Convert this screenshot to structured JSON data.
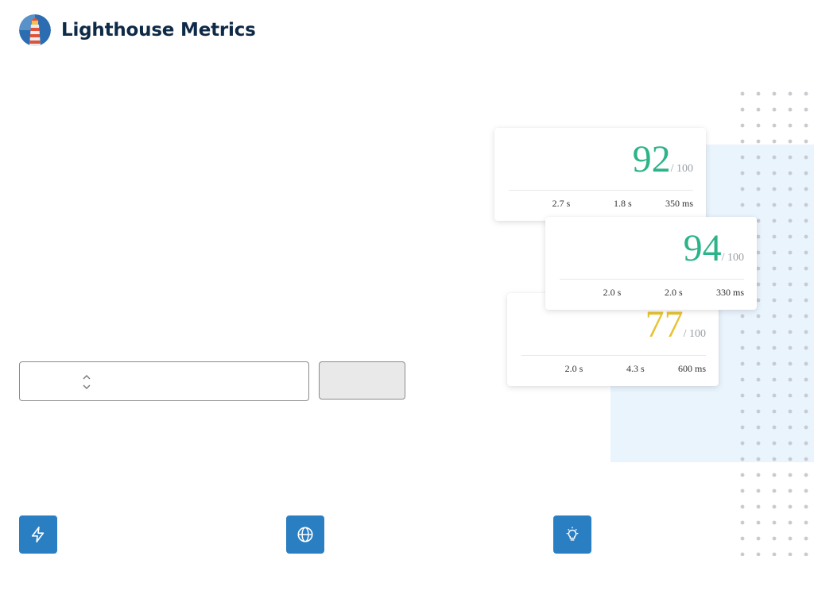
{
  "header": {
    "brand": "Lighthouse Metrics",
    "logo_icon": "lighthouse-icon"
  },
  "colors": {
    "good": "#2bb389",
    "average": "#e8c232",
    "accent": "#2a7ec2",
    "brand_text": "#0f2a47"
  },
  "cards": [
    {
      "score": "92",
      "out_of": "/ 100",
      "status": "good",
      "metrics": [
        "2.7 s",
        "1.8 s",
        "350 ms"
      ]
    },
    {
      "score": "94",
      "out_of": "/ 100",
      "status": "good",
      "metrics": [
        "2.0 s",
        "2.0 s",
        "330 ms"
      ]
    },
    {
      "score": "77",
      "out_of": "/ 100",
      "status": "average",
      "metrics": [
        "2.0 s",
        "4.3 s",
        "600 ms"
      ]
    }
  ],
  "form": {
    "select_value": "",
    "select_icon": "chevron-up-down-icon",
    "run_label": ""
  },
  "features": [
    {
      "icon": "lightning-icon"
    },
    {
      "icon": "globe-icon"
    },
    {
      "icon": "lightbulb-icon"
    }
  ]
}
